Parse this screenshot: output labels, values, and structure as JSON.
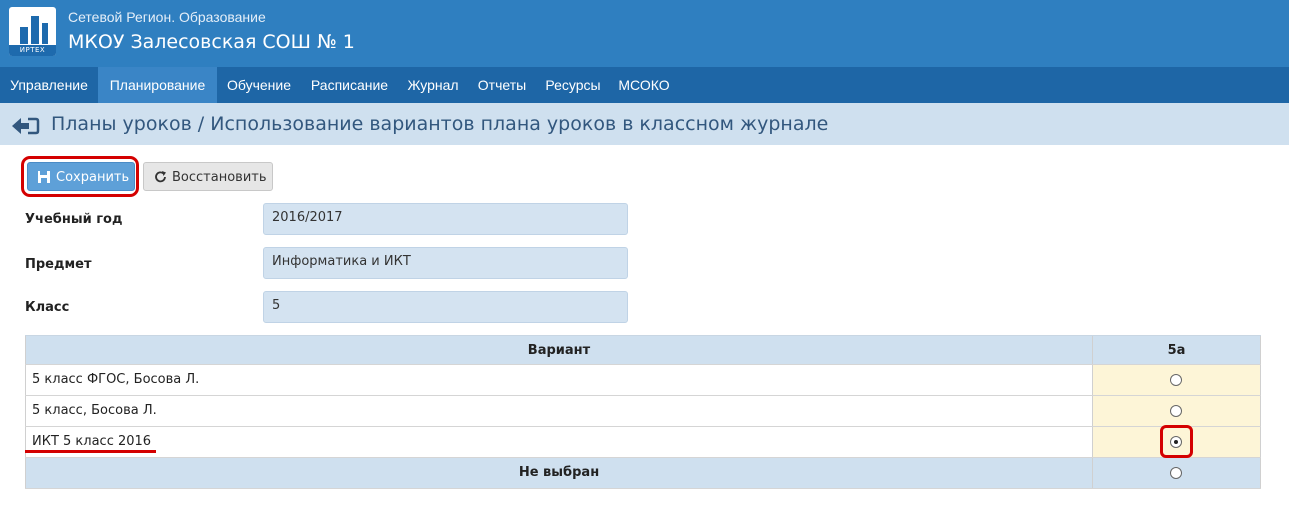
{
  "app": {
    "region_name": "Сетевой Регион. Образование",
    "school_name": "МКОУ Залесовская СОШ № 1",
    "logo_text": "ИРТЕХ"
  },
  "nav": {
    "items": [
      {
        "label": "Управление"
      },
      {
        "label": "Планирование",
        "active": true
      },
      {
        "label": "Обучение"
      },
      {
        "label": "Расписание"
      },
      {
        "label": "Журнал"
      },
      {
        "label": "Отчеты"
      },
      {
        "label": "Ресурсы"
      },
      {
        "label": "МСОКО"
      }
    ]
  },
  "page": {
    "title": "Планы уроков / Использование вариантов плана уроков в классном журнале",
    "back_icon": "arrow-left-icon"
  },
  "toolbar": {
    "save_label": "Сохранить",
    "restore_label": "Восстановить"
  },
  "form": {
    "year_label": "Учебный год",
    "year_value": "2016/2017",
    "subject_label": "Предмет",
    "subject_value": "Информатика и ИКТ",
    "class_label": "Класс",
    "class_value": "5"
  },
  "table": {
    "header_variant": "Вариант",
    "header_class": "5а",
    "rows": [
      {
        "label": "5 класс ФГОС, Босова Л.",
        "selected": false
      },
      {
        "label": "5 класс, Босова Л.",
        "selected": false
      },
      {
        "label": "ИКТ 5 класс 2016",
        "selected": true
      }
    ],
    "none_label": "Не выбран",
    "none_selected": false
  },
  "colors": {
    "header_bg": "#2f7fc0",
    "nav_bg": "#1e66a6",
    "nav_active": "#3a85c6",
    "title_bar": "#cfe0ef",
    "highlight": "#fdf5d7",
    "annotation": "#d40000"
  }
}
